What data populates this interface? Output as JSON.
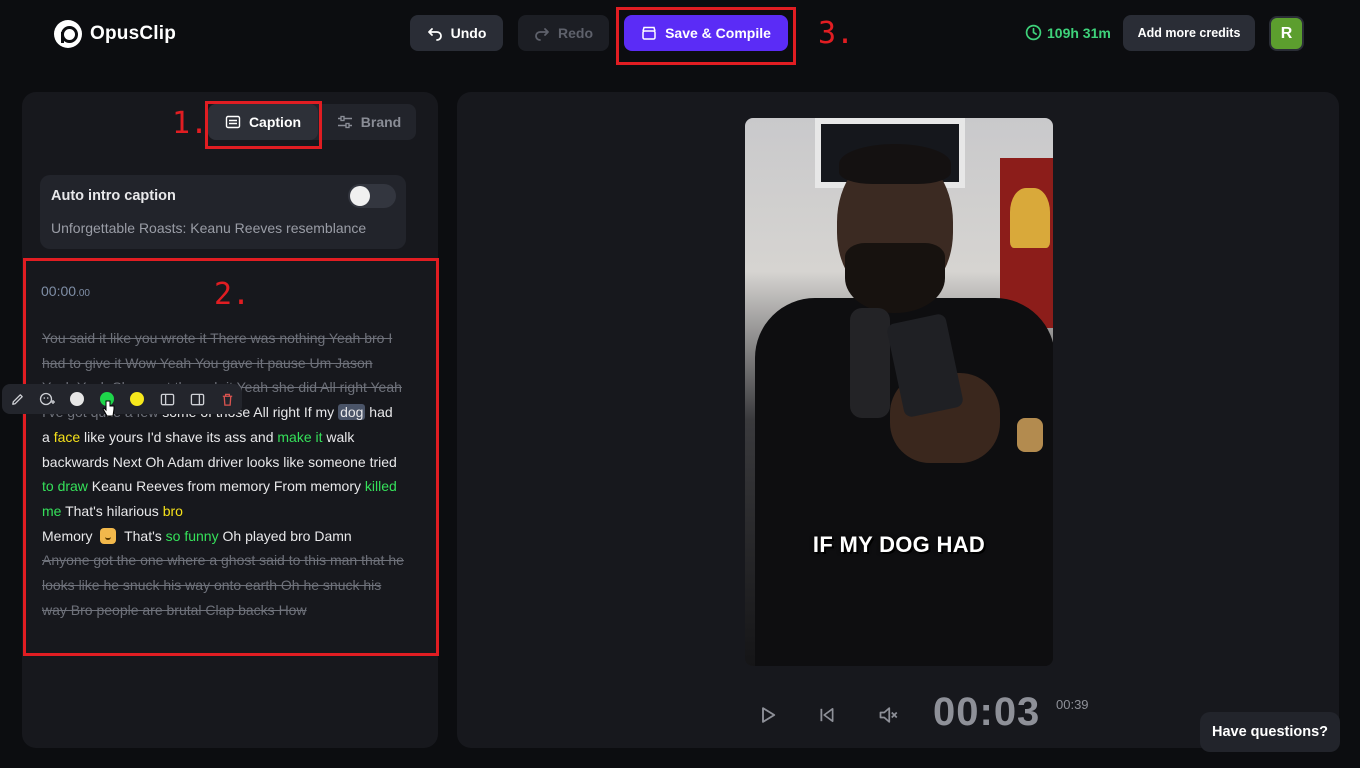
{
  "app": {
    "name": "OpusClip"
  },
  "header": {
    "undo_label": "Undo",
    "redo_label": "Redo",
    "save_label": "Save & Compile",
    "time_remaining": "109h 31m",
    "credits_label": "Add more credits",
    "avatar_initial": "R"
  },
  "annotations": {
    "one": "1.",
    "two": "2.",
    "three": "3."
  },
  "tabs": {
    "caption": "Caption",
    "brand": "Brand"
  },
  "intro": {
    "title": "Auto intro caption",
    "subtitle": "Unforgettable Roasts: Keanu Reeves resemblance",
    "enabled": false
  },
  "transcript": {
    "timestamp_main": "00:00",
    "timestamp_ms": ".00",
    "cut_1": "You said it like you wrote it There was nothing Yeah bro I had to give it Wow Yeah You gave it pause Um Jason Yeah Yeah She went through it Yeah she did All right Yeah I've got quite a few",
    "t1": " some of those All right If my ",
    "sel": "dog",
    "t2": " had a ",
    "y1": "face",
    "t3": " like yours I'd shave its ass and ",
    "g1": "make it",
    "t4": " walk backwards Next Oh Adam driver looks like someone tried ",
    "g2": "to draw",
    "t5": " Keanu Reeves from memory From memory ",
    "g3": "killed me",
    "t6": " That's hilarious ",
    "y2": "bro",
    "t7": " Memory ",
    "t8": " That's ",
    "g4": "so funny",
    "t9": " Oh played bro Damn",
    "cut_2": "Anyone got the one where a ghost said to this man that he looks like he snuck his way onto earth Oh he snuck his way Bro people are brutal Clap backs How"
  },
  "colors": {
    "accent": "#5b2cf6",
    "highlight_green": "#35e05a",
    "highlight_yellow": "#f5e11a",
    "annotation_red": "#e11d22",
    "timer_green": "#3ed27a"
  },
  "toolbar": {
    "icons": [
      "edit-icon",
      "emoji-add-icon",
      "white-dot",
      "green-dot",
      "yellow-dot",
      "split-left-icon",
      "split-right-icon",
      "trash-icon"
    ]
  },
  "video": {
    "caption": "IF MY DOG HAD",
    "current_time": "00:03",
    "duration": "00:39"
  },
  "help": {
    "label": "Have questions?"
  }
}
